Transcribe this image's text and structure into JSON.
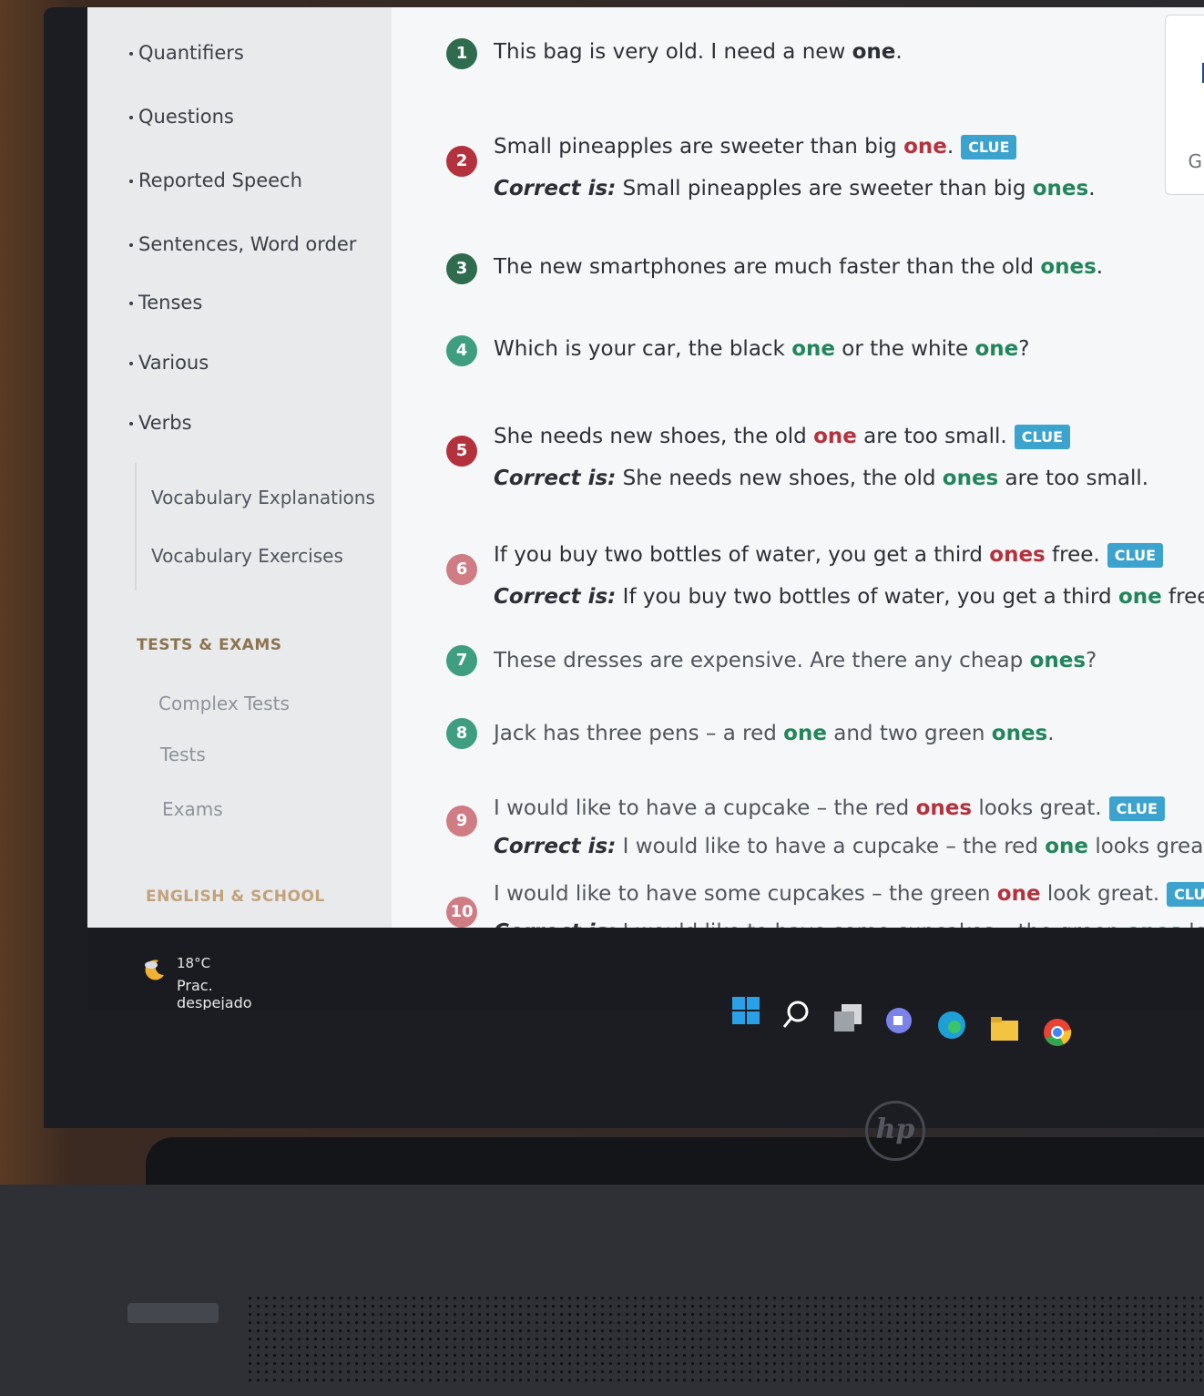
{
  "sidebar": {
    "items": [
      "Quantifiers",
      "Questions",
      "Reported Speech",
      "Sentences, Word order",
      "Tenses",
      "Various",
      "Verbs"
    ],
    "sub_links": [
      "Vocabulary Explanations",
      "Vocabulary Exercises"
    ],
    "tests_heading": "TESTS & EXAMS",
    "tests_links": [
      "Complex Tests",
      "Tests",
      "Exams"
    ],
    "school_heading": "ENGLISH & SCHOOL"
  },
  "exercise": {
    "clue_label": "CLUE",
    "correct_label": "Correct is:",
    "q1": {
      "n": "1",
      "a": "This bag is very old. I need a new ",
      "k1": "one",
      "b": "."
    },
    "q2": {
      "n": "2",
      "a": "Small pineapples are sweeter than big ",
      "k1": "one",
      "b": ".",
      "ca": " Small pineapples are sweeter than big ",
      "ck": "ones",
      "cb": "."
    },
    "q3": {
      "n": "3",
      "a": "The new smartphones are much faster than the old ",
      "k1": "ones",
      "b": "."
    },
    "q4": {
      "n": "4",
      "a": "Which is your car, the black ",
      "k1": "one",
      "b": " or the white ",
      "k2": "one",
      "c": "?"
    },
    "q5": {
      "n": "5",
      "a": "She needs new shoes, the old ",
      "k1": "one",
      "b": " are too small.",
      "ca": " She needs new shoes, the old ",
      "ck": "ones",
      "cb": " are too small."
    },
    "q6": {
      "n": "6",
      "a": "If you buy two bottles of water, you get a third ",
      "k1": "ones",
      "b": " free.",
      "ca": " If you buy two bottles of water, you get a third ",
      "ck": "one",
      "cb": " free."
    },
    "q7": {
      "n": "7",
      "a": "These dresses are expensive. Are there any cheap ",
      "k1": "ones",
      "b": "?"
    },
    "q8": {
      "n": "8",
      "a": "Jack has three pens – a red ",
      "k1": "one",
      "b": " and two green ",
      "k2": "ones",
      "c": "."
    },
    "q9": {
      "n": "9",
      "a": "I would like to have a cupcake – the red ",
      "k1": "ones",
      "b": " looks great.",
      "ca": " I would like to have a cupcake – the red ",
      "ck": "one",
      "cb": " looks great."
    },
    "q10": {
      "n": "10",
      "a": "I would like to have some cupcakes – the green ",
      "k1": "one",
      "b": " look great.",
      "ca": " I would like to have some cupcakes – the green ",
      "ck": "ones",
      "cb": " look great."
    }
  },
  "right_tab": {
    "letter": "G"
  },
  "taskbar": {
    "temperature": "18°C",
    "condition": "Prac. despejado",
    "icons": [
      "start-icon",
      "search-icon",
      "task-view-icon",
      "chat-icon",
      "edge-icon",
      "file-explorer-icon",
      "chrome-icon"
    ]
  },
  "hardware": {
    "brand": "hp"
  },
  "colors": {
    "correct": "#23855c",
    "wrong": "#b3323d",
    "clue": "#3ba3cd",
    "heading": "#8c7450"
  }
}
